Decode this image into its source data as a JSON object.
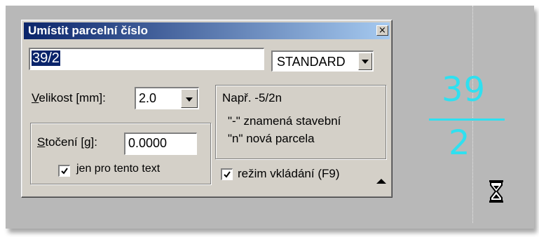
{
  "drawing": {
    "number_top": "39",
    "number_bottom": "2",
    "number_color": "#2fe0f0",
    "cursor_icon": "hourglass-icon"
  },
  "dialog": {
    "title": "Umístit parcelní číslo",
    "close_label": "×",
    "parcel_value": "39/2",
    "style_select": {
      "selected": "STANDARD"
    },
    "size": {
      "label_accel": "V",
      "label_rest": "elikost [mm]:",
      "value": "2.0"
    },
    "rotation": {
      "label_accel": "S",
      "label_rest": "točení [g]:",
      "value": "0.0000"
    },
    "only_this_text": {
      "label": "jen pro tento text",
      "checked": true
    },
    "hint": {
      "line1": "Např. -5/2n",
      "line2": "\"-\" znamená stavební",
      "line3": "\"n\" nová parcela"
    },
    "insert_mode": {
      "label": "režim vkládání (F9)",
      "checked": true
    },
    "collapse_icon": "triangle-up-icon",
    "titlebar_color": "#0a246a"
  }
}
